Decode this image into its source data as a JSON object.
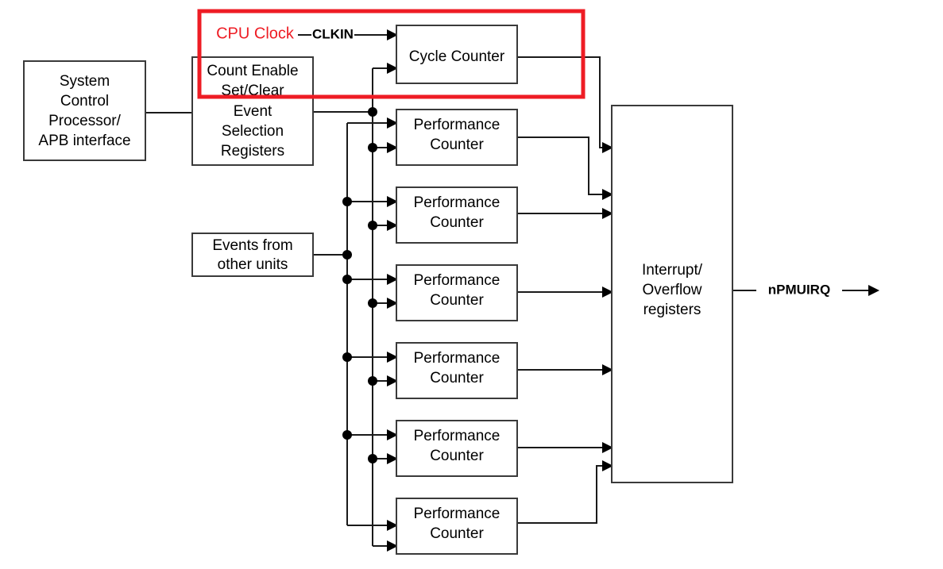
{
  "diagram": {
    "title": "PMU block diagram",
    "colors": {
      "highlight": "#ee1c24",
      "box_stroke": "#3a3a3a",
      "wire": "#1a1a1a",
      "background": "#ffffff"
    },
    "blocks": {
      "system_control": {
        "lines": [
          "System",
          "Control",
          "Processor/",
          "APB interface"
        ]
      },
      "event_selection": {
        "lines": [
          "Count Enable",
          "Set/Clear",
          "Event",
          "Selection",
          "Registers"
        ]
      },
      "events_source": {
        "lines": [
          "Events from",
          "other units"
        ]
      },
      "cycle_counter": {
        "lines": [
          "Cycle Counter"
        ]
      },
      "interrupt": {
        "lines": [
          "Interrupt/",
          "Overflow",
          "registers"
        ]
      },
      "performance_counters": [
        {
          "lines": [
            "Performance",
            "Counter"
          ]
        },
        {
          "lines": [
            "Performance",
            "Counter"
          ]
        },
        {
          "lines": [
            "Performance",
            "Counter"
          ]
        },
        {
          "lines": [
            "Performance",
            "Counter"
          ]
        },
        {
          "lines": [
            "Performance",
            "Counter"
          ]
        },
        {
          "lines": [
            "Performance",
            "Counter"
          ]
        }
      ]
    },
    "signals": {
      "cpu_clock": "CPU Clock",
      "clkin": "CLKIN",
      "npmuirq": "nPMUIRQ"
    }
  }
}
